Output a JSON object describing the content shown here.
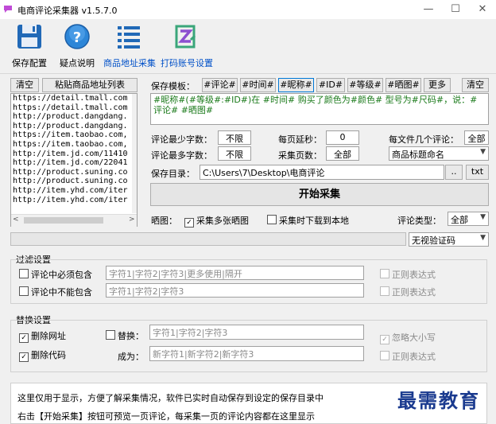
{
  "window": {
    "title": "电商评论采集器 v1.5.7.0",
    "min": "—",
    "max": "☐",
    "close": "✕"
  },
  "toolbar": [
    {
      "label": "保存配置",
      "icon": "save-icon"
    },
    {
      "label": "疑点说明",
      "icon": "help-icon"
    },
    {
      "label": "商品地址采集",
      "icon": "list-icon"
    },
    {
      "label": "打码账号设置",
      "icon": "captcha-icon"
    }
  ],
  "left": {
    "clear": "清空",
    "paste": "粘贴商品地址列表",
    "urls": [
      "https://detail.tmall.com",
      "https://detail.tmall.com",
      "http://product.dangdang.",
      "http://product.dangdang.",
      "https://item.taobao.com,",
      "https://item.taobao.com,",
      "http://item.jd.com/11410",
      "http://item.jd.com/22041",
      "http://product.suning.co",
      "http://product.suning.co",
      "http://item.yhd.com/iter",
      "http://item.yhd.com/iter"
    ]
  },
  "template": {
    "label": "保存模板：",
    "tags": [
      "#评论#",
      "#时间#",
      "#昵称#",
      "#ID#",
      "#等级#",
      "#晒图#"
    ],
    "more": "更多",
    "clear": "清空",
    "text": "#昵称#(#等级#:#ID#)在 #时间# 购买了颜色为#颜色# 型号为#尺码#，说：#评论# #晒图#"
  },
  "settings": {
    "min_len_label": "评论最少字数：",
    "min_len": "不限",
    "max_len_label": "评论最多字数：",
    "max_len": "不限",
    "delay_label": "每页延秒：",
    "delay": "0",
    "pages_label": "采集页数：",
    "pages": "全部",
    "per_file_label": "每文件几个评论：",
    "per_file": "全部",
    "naming": "商品标题命名",
    "dir_label": "保存目录：",
    "dir": "C:\\Users\\7\\Desktop\\电商评论",
    "browse": "..",
    "txt": "txt",
    "start": "开始采集",
    "pic_label": "晒图：",
    "multi_pic": "采集多张晒图",
    "download": "采集时下载到本地",
    "type_label": "评论类型：",
    "type": "全部",
    "captcha": "无视验证码"
  },
  "filter": {
    "title": "过滤设置",
    "must_label": "评论中必须包含",
    "must_ph": "字符1|字符2|字符3|更多使用|隔开",
    "not_label": "评论中不能包含",
    "not_ph": "字符1|字符2|字符3",
    "regex": "正则表达式"
  },
  "replace": {
    "title": "替换设置",
    "del_url": "删除网址",
    "del_code": "删除代码",
    "replace_label": "替换：",
    "replace_ph": "字符1|字符2|字符3",
    "to_label": "成为：",
    "to_ph": "新字符1|新字符2|新字符3",
    "ignore_case": "忽略大小写",
    "regex": "正则表达式"
  },
  "info": {
    "line1": "这里仅用于显示，方便了解采集情况，软件已实时自动保存到设定的保存目录中",
    "line2": "右击【开始采集】按钮可预览一页评论，每采集一页的评论内容都在这里显示"
  },
  "watermark": "最需教育"
}
